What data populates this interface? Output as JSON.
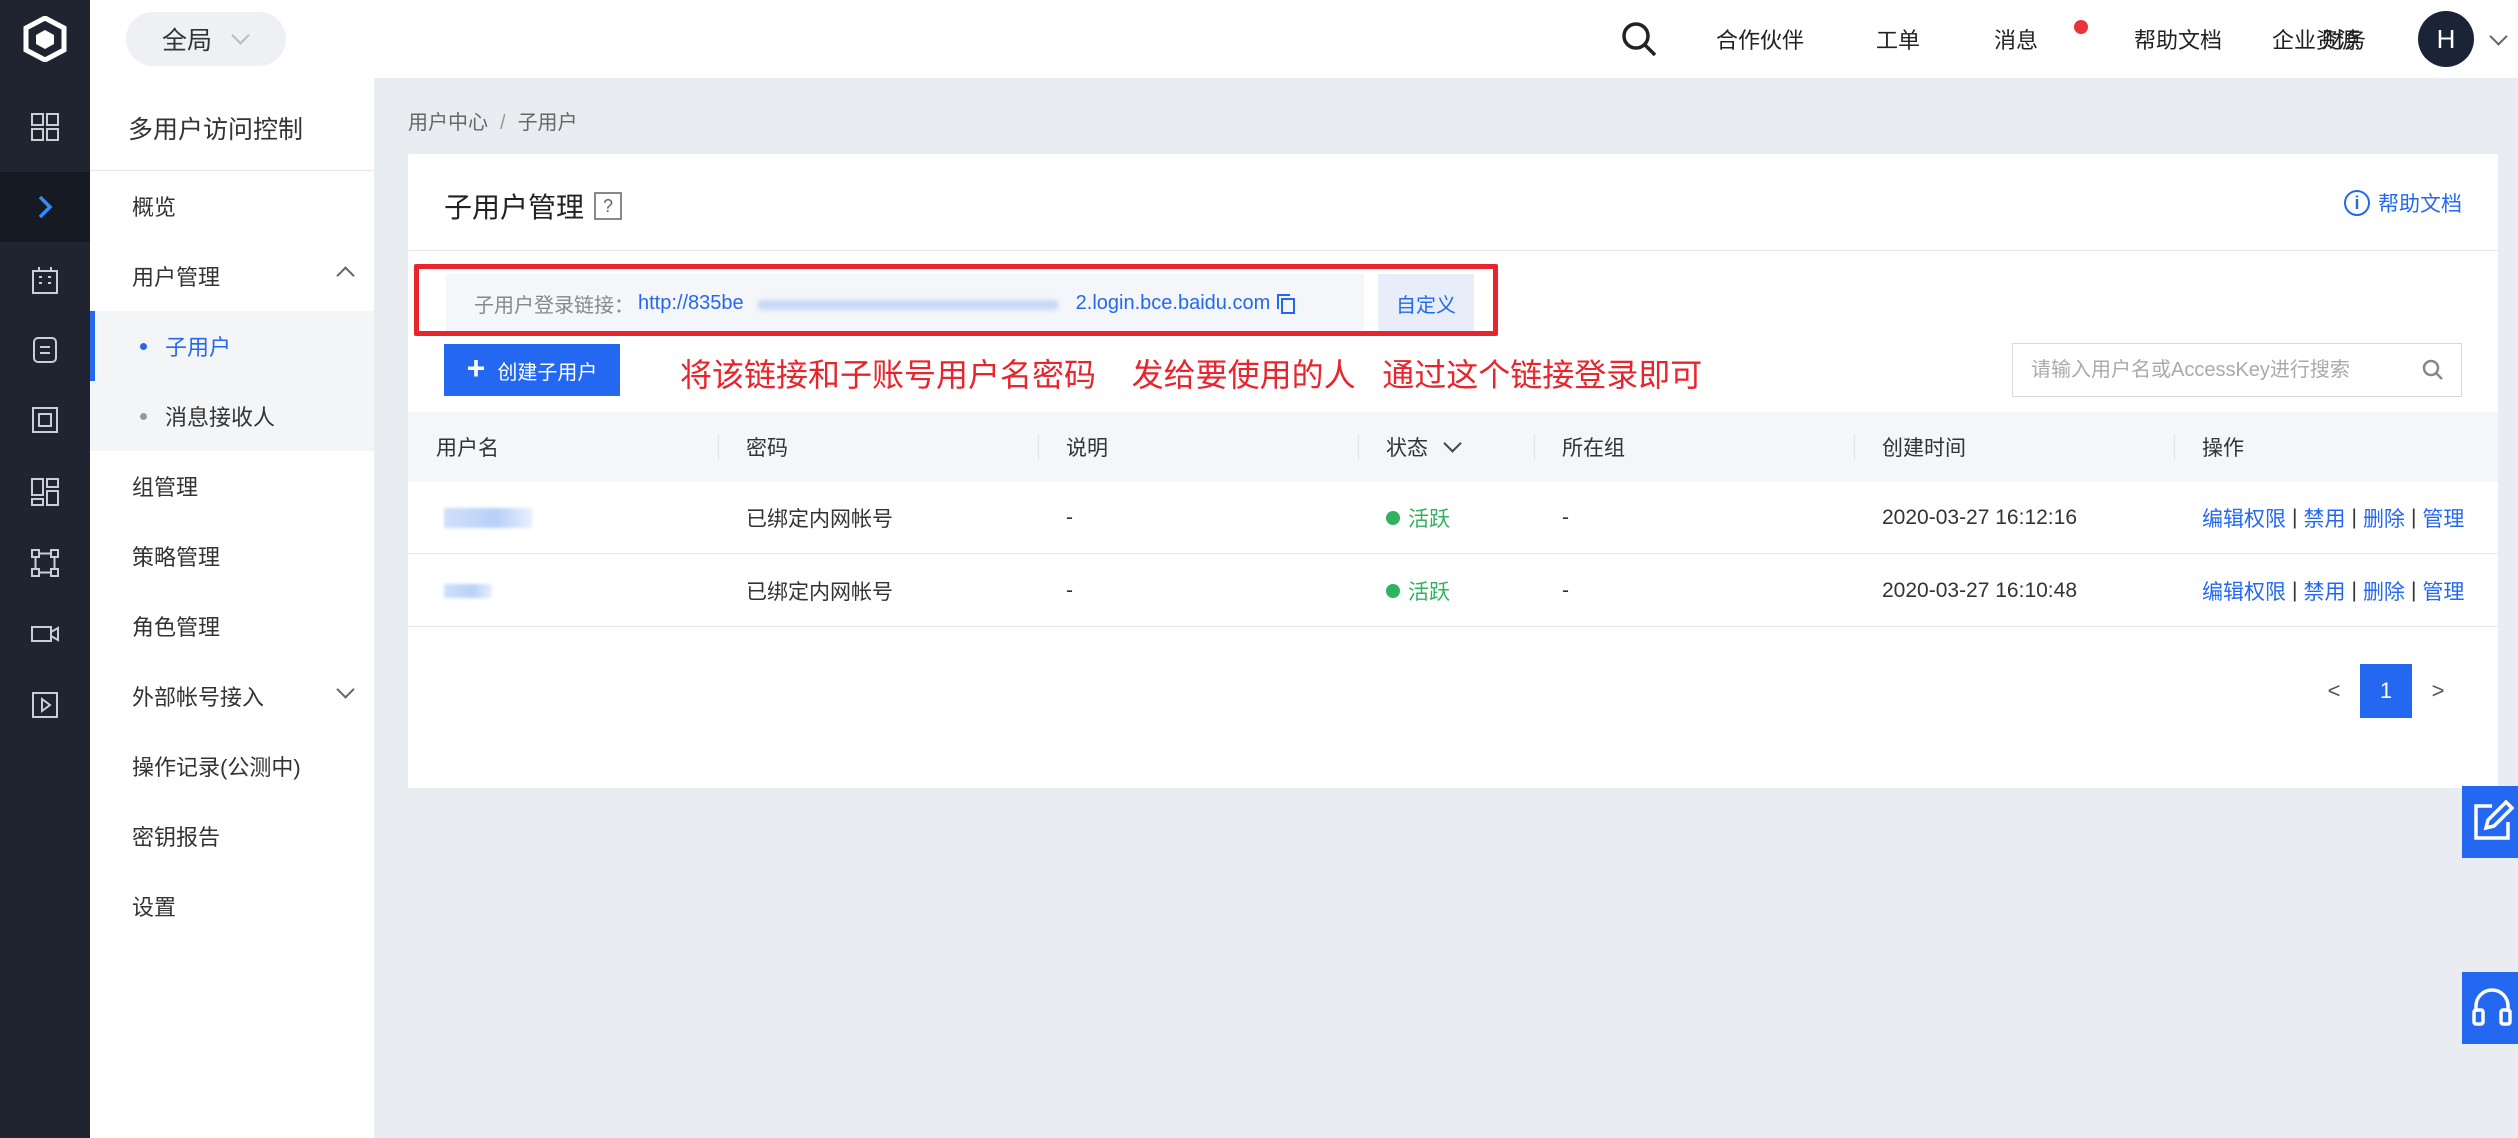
{
  "colors": {
    "brand": "#2468f2",
    "rail_bg": "#1f2430",
    "annotation_red": "#e8242c",
    "status_active": "#2fb35e"
  },
  "rail_icons": [
    "logo-icon",
    "grid-icon",
    "chevron-right-icon",
    "building-icon",
    "database-icon",
    "server-icon",
    "dashboard-icon",
    "network-icon",
    "camera-icon",
    "play-icon"
  ],
  "topbar": {
    "scope": "全局",
    "nav": [
      "合作伙伴",
      "工单",
      "消息",
      "帮助文档",
      "企业资源",
      "财务"
    ],
    "avatar": "H"
  },
  "sidebar": {
    "title": "多用户访问控制",
    "items": [
      "概览",
      "用户管理",
      "子用户",
      "消息接收人",
      "组管理",
      "策略管理",
      "角色管理",
      "外部帐号接入",
      "操作记录(公测中)",
      "密钥报告",
      "设置"
    ]
  },
  "breadcrumb": [
    "用户中心",
    "子用户"
  ],
  "main": {
    "title": "子用户管理",
    "help_q": "?",
    "help_icon": "i",
    "help_link": "帮助文档",
    "login_label": "子用户登录链接：",
    "login_url_start": "http://835be",
    "login_url_end": "2.login.bce.baidu.com",
    "custom_button": "自定义",
    "create_button": "创建子用户",
    "create_plus": "+",
    "annotation": "将该链接和子账号用户名密码    发给要使用的人   通过这个链接登录即可",
    "search_placeholder": "请输入用户名或AccessKey进行搜索"
  },
  "table": {
    "columns": [
      "用户名",
      "密码",
      "说明",
      "状态",
      "所在组",
      "创建时间",
      "操作"
    ],
    "rows": [
      {
        "password": "已绑定内网帐号",
        "desc": "-",
        "status": "活跃",
        "group": "-",
        "created": "2020-03-27 16:12:16"
      },
      {
        "password": "已绑定内网帐号",
        "desc": "-",
        "status": "活跃",
        "group": "-",
        "created": "2020-03-27 16:10:48"
      }
    ],
    "actions": [
      "编辑权限",
      "禁用",
      "删除",
      "管理"
    ],
    "action_sep": "|"
  },
  "pagination": {
    "prev": "<",
    "current": "1",
    "next": ">"
  }
}
